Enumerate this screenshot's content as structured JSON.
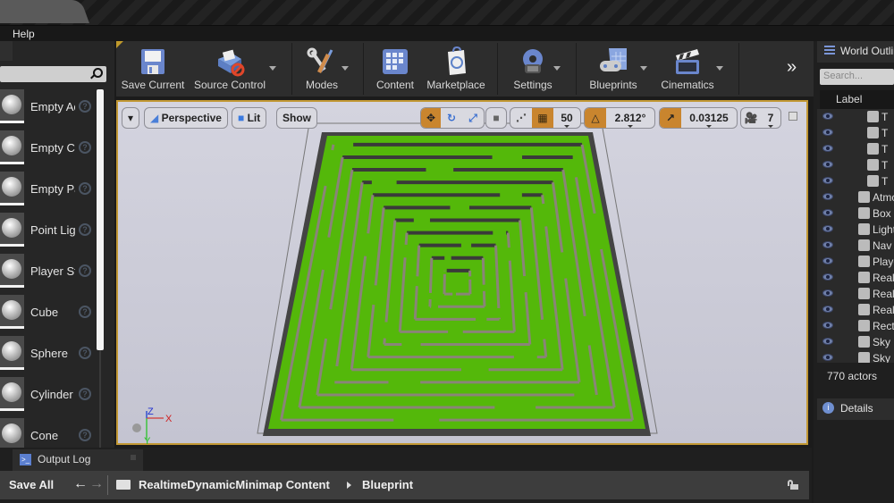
{
  "menu": {
    "help": "Help"
  },
  "toolbar": {
    "buttons": [
      {
        "label": "Save Current",
        "icon": "floppy-disk-icon"
      },
      {
        "label": "Source Control",
        "icon": "source-control-icon",
        "has_dropdown": true
      },
      {
        "label": "Modes",
        "icon": "modes-wrench-brush-icon",
        "has_dropdown": true
      },
      {
        "label": "Content",
        "icon": "content-grid-icon"
      },
      {
        "label": "Marketplace",
        "icon": "marketplace-bag-icon"
      },
      {
        "label": "Settings",
        "icon": "settings-gear-icon",
        "has_dropdown": true
      },
      {
        "label": "Blueprints",
        "icon": "blueprint-gamepad-icon",
        "has_dropdown": true
      },
      {
        "label": "Cinematics",
        "icon": "clapperboard-icon",
        "has_dropdown": true
      }
    ],
    "overflow": "»"
  },
  "place_panel": {
    "items": [
      {
        "label": "Empty Actor",
        "icon": "sphere-thumb"
      },
      {
        "label": "Empty Character",
        "icon": "mannequin-thumb"
      },
      {
        "label": "Empty Pawn",
        "icon": "pawn-thumb"
      },
      {
        "label": "Point Light",
        "icon": "bulb-thumb"
      },
      {
        "label": "Player Start",
        "icon": "player-start-thumb"
      },
      {
        "label": "Cube",
        "icon": "cube-thumb"
      },
      {
        "label": "Sphere",
        "icon": "sphere-thumb"
      },
      {
        "label": "Cylinder",
        "icon": "cylinder-thumb"
      },
      {
        "label": "Cone",
        "icon": "cone-thumb"
      }
    ],
    "help_glyph": "?"
  },
  "viewport": {
    "menu_glyph": "▾",
    "perspective": "Perspective",
    "lit": "Lit",
    "show": "Show",
    "grid_snap": "50",
    "rotation_snap": "2.812°",
    "scale_snap": "0.03125",
    "camera_speed": "7",
    "accent": "#c9852e",
    "axis": {
      "z": "Z",
      "x": "X",
      "y": "Y"
    }
  },
  "outliner": {
    "title": "World Outliner",
    "search_placeholder": "Search...",
    "column": "Label",
    "rows": [
      {
        "text": "T",
        "indent": 2
      },
      {
        "text": "T",
        "indent": 2
      },
      {
        "text": "T",
        "indent": 2
      },
      {
        "text": "T",
        "indent": 2
      },
      {
        "text": "T",
        "indent": 2
      },
      {
        "text": "Atmospheric Fog",
        "indent": 1
      },
      {
        "text": "Box",
        "indent": 1
      },
      {
        "text": "Light",
        "indent": 1
      },
      {
        "text": "Nav",
        "indent": 1
      },
      {
        "text": "Player",
        "indent": 1
      },
      {
        "text": "Real",
        "indent": 1
      },
      {
        "text": "Real",
        "indent": 1
      },
      {
        "text": "Real",
        "indent": 1
      },
      {
        "text": "Rect",
        "indent": 1
      },
      {
        "text": "Sky",
        "indent": 1
      },
      {
        "text": "Sky",
        "indent": 1
      }
    ],
    "actor_count": "770 actors",
    "details": "Details"
  },
  "bottom": {
    "output_log": "Output Log",
    "save_all": "Save All",
    "path": [
      "RealtimeDynamicMinimap Content",
      "Blueprint"
    ]
  }
}
